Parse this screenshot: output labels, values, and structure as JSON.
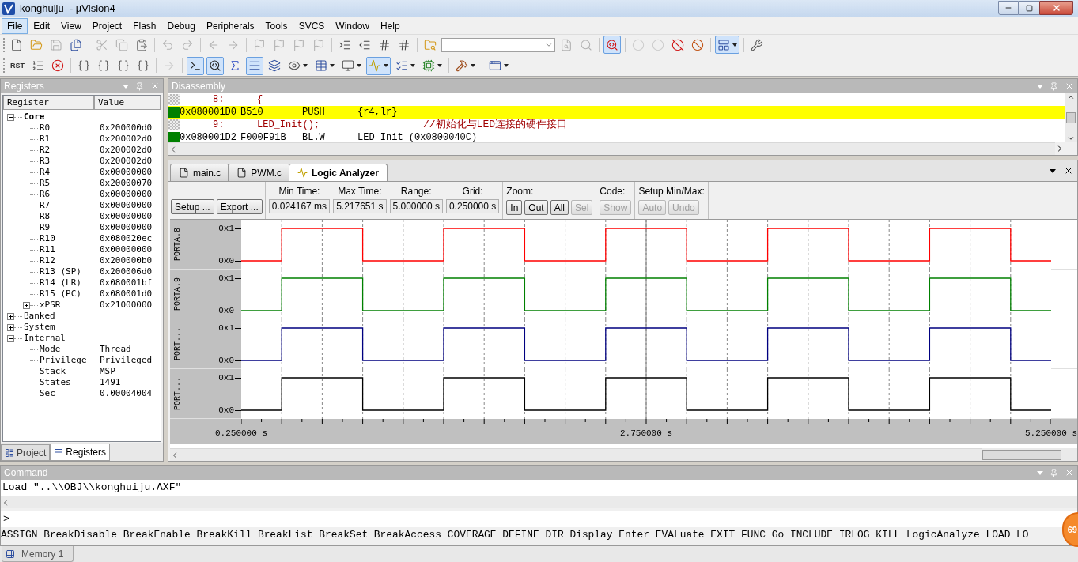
{
  "window": {
    "title": "konghuiju  - µVision4"
  },
  "menu": [
    {
      "label": "File",
      "selected": true
    },
    {
      "label": "Edit",
      "selected": false
    },
    {
      "label": "View",
      "selected": false
    },
    {
      "label": "Project",
      "selected": false
    },
    {
      "label": "Flash",
      "selected": false
    },
    {
      "label": "Debug",
      "selected": false
    },
    {
      "label": "Peripherals",
      "selected": false
    },
    {
      "label": "Tools",
      "selected": false
    },
    {
      "label": "SVCS",
      "selected": false
    },
    {
      "label": "Window",
      "selected": false
    },
    {
      "label": "Help",
      "selected": false
    }
  ],
  "file_toolbar": [
    [
      {
        "kind": "button",
        "disabled": false,
        "pressed": false
      },
      {
        "kind": "button",
        "disabled": false,
        "pressed": false
      },
      {
        "kind": "button",
        "disabled": true,
        "pressed": false
      },
      {
        "kind": "button",
        "disabled": false,
        "pressed": false
      }
    ],
    [
      {
        "kind": "button",
        "disabled": true,
        "pressed": false
      },
      {
        "kind": "button",
        "disabled": true,
        "pressed": false
      },
      {
        "kind": "button",
        "disabled": false,
        "pressed": false
      }
    ],
    [
      {
        "kind": "button",
        "disabled": true,
        "pressed": false
      },
      {
        "kind": "button",
        "disabled": true,
        "pressed": false
      }
    ],
    [
      {
        "kind": "button",
        "disabled": true,
        "pressed": false
      },
      {
        "kind": "button",
        "disabled": true,
        "pressed": false
      }
    ],
    [
      {
        "kind": "button",
        "disabled": true,
        "pressed": false
      },
      {
        "kind": "button",
        "disabled": true,
        "pressed": false
      },
      {
        "kind": "button",
        "disabled": true,
        "pressed": false
      },
      {
        "kind": "button",
        "disabled": true,
        "pressed": false
      }
    ],
    [
      {
        "kind": "button",
        "disabled": false,
        "pressed": false
      },
      {
        "kind": "button",
        "disabled": false,
        "pressed": false
      },
      {
        "kind": "button",
        "disabled": false,
        "pressed": false
      },
      {
        "kind": "button",
        "disabled": false,
        "pressed": false
      }
    ],
    [
      {
        "kind": "button",
        "disabled": false,
        "pressed": false
      },
      {
        "kind": "combo"
      },
      {
        "kind": "button",
        "disabled": true,
        "pressed": false
      },
      {
        "kind": "button",
        "disabled": true,
        "pressed": false
      }
    ],
    [
      {
        "kind": "button",
        "disabled": false,
        "pressed": true
      }
    ],
    [
      {
        "kind": "button",
        "disabled": true,
        "pressed": false
      },
      {
        "kind": "button",
        "disabled": true,
        "pressed": false
      },
      {
        "kind": "button",
        "disabled": false,
        "pressed": false
      },
      {
        "kind": "button",
        "disabled": false,
        "pressed": false
      }
    ],
    [
      {
        "kind": "dropdown",
        "disabled": false,
        "pressed": true
      }
    ],
    [
      {
        "kind": "button",
        "disabled": false,
        "pressed": false
      }
    ]
  ],
  "debug_toolbar": [
    [
      {
        "kind": "text",
        "label": "RST",
        "disabled": false,
        "pressed": false
      },
      {
        "kind": "button",
        "disabled": false,
        "pressed": false
      },
      {
        "kind": "button",
        "disabled": false,
        "pressed": false
      }
    ],
    [
      {
        "kind": "button",
        "disabled": false,
        "pressed": false
      },
      {
        "kind": "button",
        "disabled": false,
        "pressed": false
      },
      {
        "kind": "button",
        "disabled": false,
        "pressed": false
      },
      {
        "kind": "button",
        "disabled": false,
        "pressed": false
      }
    ],
    [
      {
        "kind": "button",
        "disabled": true,
        "pressed": false
      }
    ],
    [
      {
        "kind": "button",
        "disabled": false,
        "pressed": true
      },
      {
        "kind": "button",
        "disabled": false,
        "pressed": true
      },
      {
        "kind": "button",
        "disabled": false,
        "pressed": false
      },
      {
        "kind": "button",
        "disabled": false,
        "pressed": true
      },
      {
        "kind": "button",
        "disabled": false,
        "pressed": false
      },
      {
        "kind": "dropdown",
        "disabled": false,
        "pressed": false
      },
      {
        "kind": "dropdown",
        "disabled": false,
        "pressed": false
      },
      {
        "kind": "dropdown",
        "disabled": false,
        "pressed": false
      },
      {
        "kind": "dropdown",
        "disabled": false,
        "pressed": true
      },
      {
        "kind": "dropdown",
        "disabled": false,
        "pressed": false
      },
      {
        "kind": "dropdown",
        "disabled": false,
        "pressed": false
      }
    ],
    [
      {
        "kind": "dropdown",
        "disabled": false,
        "pressed": false
      }
    ],
    [
      {
        "kind": "dropdown",
        "disabled": false,
        "pressed": false
      }
    ]
  ],
  "registers_panel": {
    "title": "Registers",
    "columns": [
      "Register",
      "Value"
    ],
    "tree": [
      {
        "name": "Core",
        "bold": true,
        "expanded": true,
        "children": [
          {
            "name": "R0",
            "value": "0x200000d0"
          },
          {
            "name": "R1",
            "value": "0x200002d0"
          },
          {
            "name": "R2",
            "value": "0x200002d0"
          },
          {
            "name": "R3",
            "value": "0x200002d0"
          },
          {
            "name": "R4",
            "value": "0x00000000"
          },
          {
            "name": "R5",
            "value": "0x20000070"
          },
          {
            "name": "R6",
            "value": "0x00000000"
          },
          {
            "name": "R7",
            "value": "0x00000000"
          },
          {
            "name": "R8",
            "value": "0x00000000"
          },
          {
            "name": "R9",
            "value": "0x00000000"
          },
          {
            "name": "R10",
            "value": "0x080020ec"
          },
          {
            "name": "R11",
            "value": "0x00000000"
          },
          {
            "name": "R12",
            "value": "0x200000b0"
          },
          {
            "name": "R13 (SP)",
            "value": "0x200006d0"
          },
          {
            "name": "R14 (LR)",
            "value": "0x080001bf"
          },
          {
            "name": "R15 (PC)",
            "value": "0x080001d0"
          },
          {
            "name": "xPSR",
            "value": "0x21000000",
            "expanded": false
          }
        ]
      },
      {
        "name": "Banked",
        "bold": false,
        "expanded": false
      },
      {
        "name": "System",
        "bold": false,
        "expanded": false
      },
      {
        "name": "Internal",
        "bold": false,
        "expanded": true,
        "children": [
          {
            "name": "Mode",
            "value": "Thread"
          },
          {
            "name": "Privilege",
            "value": "Privileged"
          },
          {
            "name": "Stack",
            "value": "MSP"
          },
          {
            "name": "States",
            "value": "1491"
          },
          {
            "name": "Sec",
            "value": "0.00004004"
          }
        ]
      }
    ],
    "tabs": [
      {
        "label": "Project",
        "selected": false
      },
      {
        "label": "Registers",
        "selected": true
      }
    ]
  },
  "disassembly": {
    "title": "Disassembly",
    "lines": [
      {
        "kind": "source",
        "current": false,
        "line_no": "8:",
        "code": "{"
      },
      {
        "kind": "asm",
        "current": true,
        "address": "0x080001D0",
        "opcode": "B510",
        "mnemonic": "PUSH",
        "operands": "{r4,lr}"
      },
      {
        "kind": "source",
        "current": false,
        "line_no": "9:",
        "code": "LED_Init();",
        "comment": "//初始化与LED连接的硬件接口"
      },
      {
        "kind": "asm",
        "current": false,
        "address": "0x080001D2",
        "opcode": "F000F91B",
        "mnemonic": "BL.W",
        "operands": "LED_Init (0x0800040C)"
      }
    ]
  },
  "editor_tabs": [
    {
      "label": "main.c",
      "selected": false
    },
    {
      "label": "PWM.c",
      "selected": false
    },
    {
      "label": "Logic Analyzer",
      "selected": true
    }
  ],
  "logic_analyzer": {
    "actions": [
      {
        "label": "Setup ...",
        "disabled": false
      },
      {
        "label": "Export ...",
        "disabled": false
      }
    ],
    "readouts": [
      {
        "label": "Min Time:",
        "value": "0.024167 ms"
      },
      {
        "label": "Max Time:",
        "value": "5.217651 s"
      },
      {
        "label": "Range:",
        "value": "5.000000 s"
      },
      {
        "label": "Grid:",
        "value": "0.250000 s"
      }
    ],
    "groups": [
      {
        "label": "Zoom:",
        "buttons": [
          {
            "label": "In",
            "disabled": false
          },
          {
            "label": "Out",
            "disabled": false
          },
          {
            "label": "All",
            "disabled": false
          },
          {
            "label": "Sel",
            "disabled": true
          }
        ]
      },
      {
        "label": "Code:",
        "buttons": [
          {
            "label": "Show",
            "disabled": true
          }
        ]
      },
      {
        "label": "Setup Min/Max:",
        "buttons": [
          {
            "label": "Auto",
            "disabled": true
          },
          {
            "label": "Undo",
            "disabled": true
          }
        ]
      }
    ],
    "signals": [
      {
        "name": "PORTA.8",
        "color": "#ff0000",
        "high_label": "0x1",
        "low_label": "0x0"
      },
      {
        "name": "PORTA.9",
        "color": "#008000",
        "high_label": "0x1",
        "low_label": "0x0"
      },
      {
        "name": "PORT...",
        "color": "#000080",
        "high_label": "0x1",
        "low_label": "0x0"
      },
      {
        "name": "PORT...",
        "color": "#000000",
        "high_label": "0x1",
        "low_label": "0x0"
      }
    ],
    "time_labels": [
      "0.250000 s",
      "2.750000 s",
      "5.250000 s"
    ]
  },
  "command": {
    "title": "Command",
    "output": "Load \"..\\\\OBJ\\\\konghuiju.AXF\"",
    "prompt": ">",
    "hint": "ASSIGN BreakDisable BreakEnable BreakKill BreakList BreakSet BreakAccess COVERAGE DEFINE DIR Display Enter EVALuate EXIT FUNC Go INCLUDE IRLOG KILL LogicAnalyze LOAD LO"
  },
  "bottom_tabs": [
    {
      "label": "Memory 1",
      "selected": true
    }
  ],
  "floating_badge": "69"
}
